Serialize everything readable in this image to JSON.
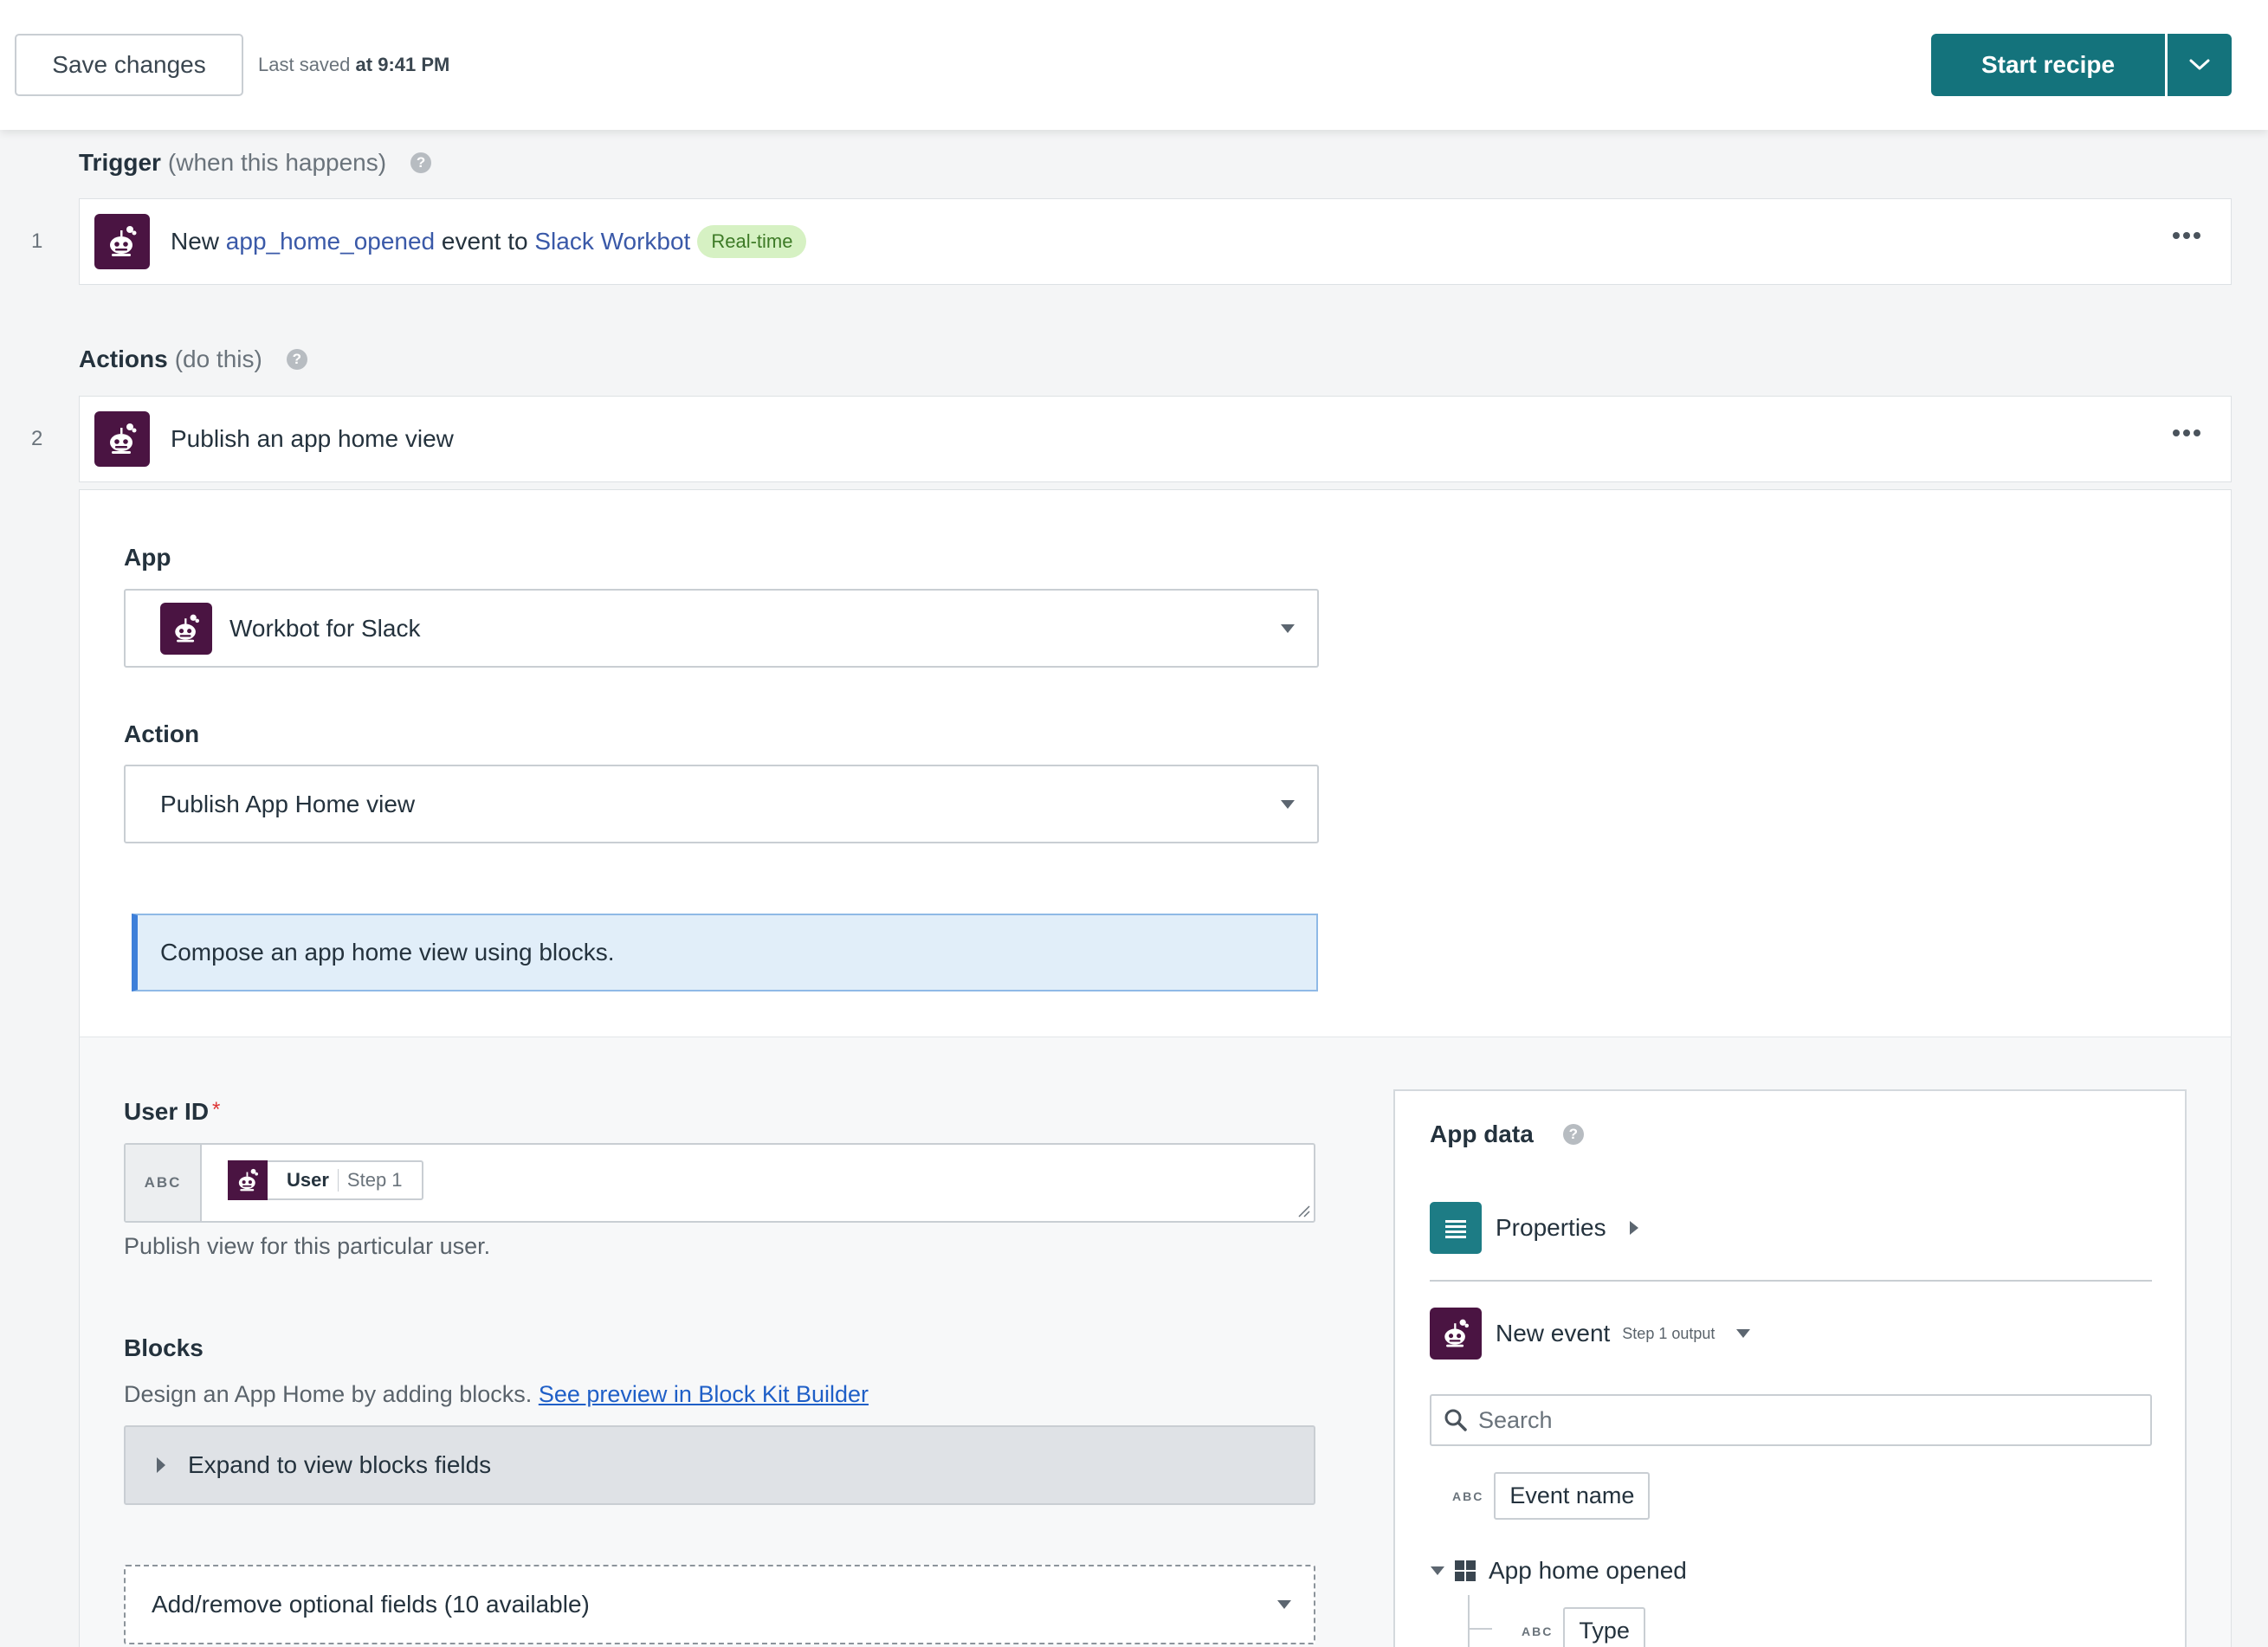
{
  "header": {
    "save_label": "Save changes",
    "last_saved_prefix": "Last saved",
    "last_saved_time": "at 9:41 PM",
    "start_label": "Start recipe"
  },
  "trigger": {
    "label": "Trigger",
    "sub": "(when this happens)",
    "step_number": "1",
    "text_new": "New",
    "event_name": "app_home_opened",
    "text_event_to": "event to",
    "app_link": "Slack Workbot",
    "badge": "Real-time"
  },
  "actions": {
    "label": "Actions",
    "sub": "(do this)",
    "step_number": "2",
    "step_title": "Publish an app home view"
  },
  "form": {
    "app_label": "App",
    "app_value": "Workbot for Slack",
    "action_label": "Action",
    "action_value": "Publish App Home view",
    "info": "Compose an app home view using blocks.",
    "user_id_label": "User ID",
    "required_mark": "*",
    "abc": "ABC",
    "user_chip_name": "User",
    "user_chip_step": "Step 1",
    "user_id_hint": "Publish view for this particular user.",
    "blocks_label": "Blocks",
    "blocks_hint": "Design an App Home by adding blocks.",
    "blocks_link": "See preview in Block Kit Builder",
    "expand_label": "Expand to view blocks fields",
    "optional_label": "Add/remove optional fields (10 available)"
  },
  "app_data": {
    "title": "App data",
    "properties": "Properties",
    "new_event": "New event",
    "new_event_sub": "Step 1 output",
    "search_placeholder": "Search",
    "abc": "ABC",
    "field_event_name": "Event name",
    "group_app_home_opened": "App home opened",
    "field_type": "Type"
  },
  "colors": {
    "accent": "#14737c",
    "slack_logo_bg": "#4a1442",
    "link": "#3a59a8",
    "badge_bg": "#d6f1c3"
  }
}
